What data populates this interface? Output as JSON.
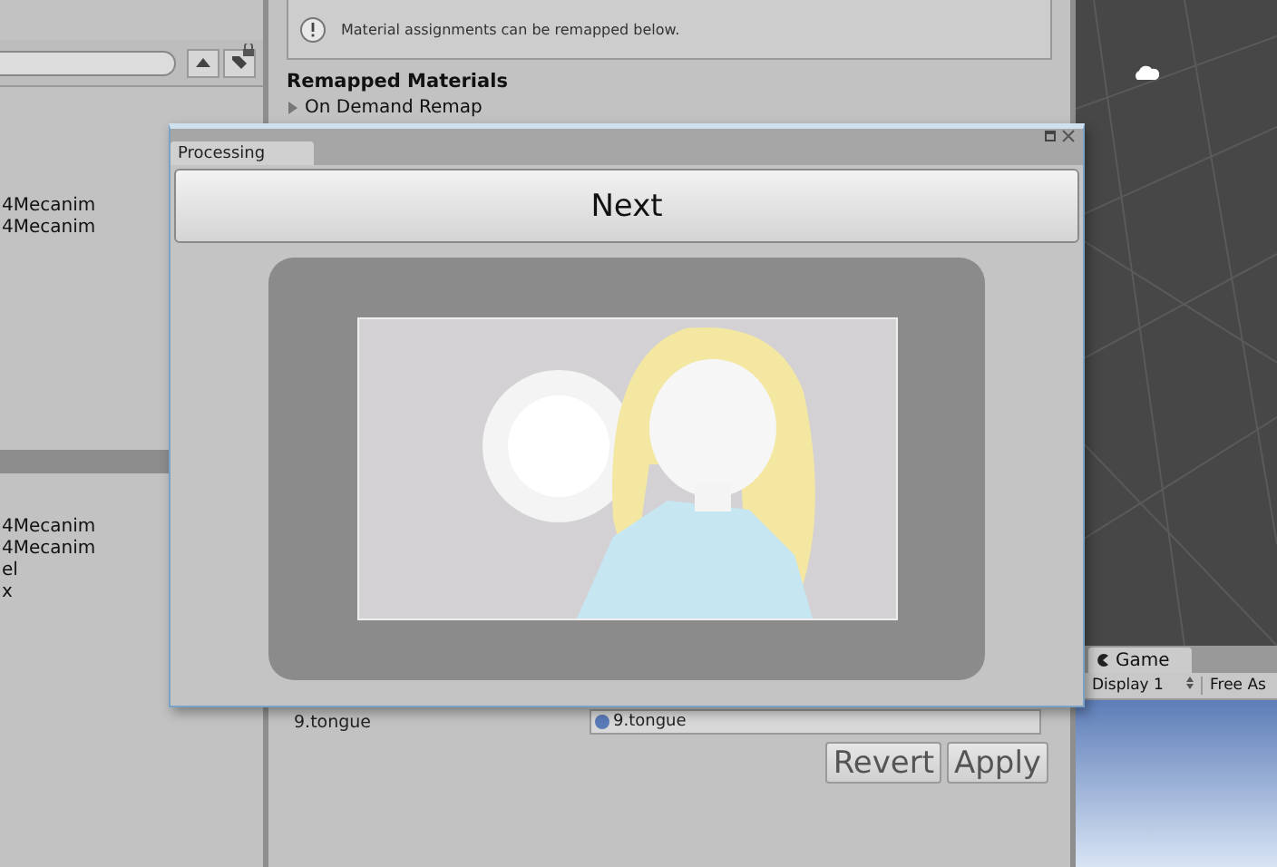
{
  "left_panel": {
    "upper_items": [
      "4Mecanim",
      "4Mecanim"
    ],
    "lower_items": [
      "4Mecanim",
      "4Mecanim",
      "el",
      "x"
    ]
  },
  "inspector": {
    "notice": "Material assignments can be remapped below.",
    "section_title": "Remapped Materials",
    "foldout": {
      "label": "On Demand Remap",
      "expanded": false
    },
    "material_row": {
      "name": "9.tongue",
      "value": "9.tongue"
    },
    "buttons": [
      "Revert",
      "Apply"
    ]
  },
  "game_panel": {
    "tab": "Game",
    "display": "Display 1",
    "aspect": "Free As"
  },
  "window": {
    "tab": "Processing",
    "button": "Next"
  }
}
